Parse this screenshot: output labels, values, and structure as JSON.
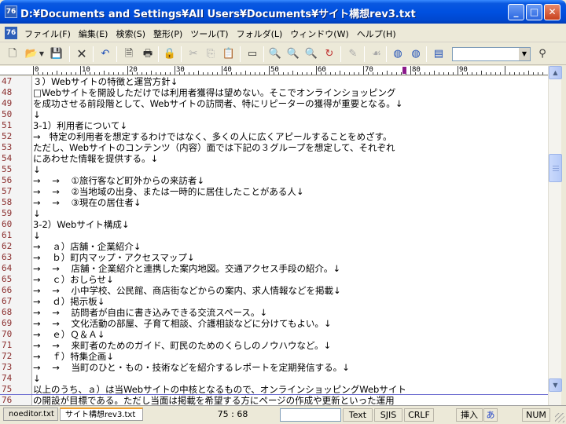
{
  "window": {
    "title": "D:¥Documents and Settings¥All Users¥Documents¥サイト構想rev3.txt",
    "app_icon": "76",
    "minimize": "_",
    "maximize": "□",
    "close": "✕"
  },
  "menu": [
    "ファイル(F)",
    "編集(E)",
    "検索(S)",
    "整形(P)",
    "ツール(T)",
    "フォルダ(L)",
    "ウィンドウ(W)",
    "ヘルプ(H)"
  ],
  "toolbar": {
    "icons": [
      "new-file-icon",
      "open-folder-icon",
      "dropdown-arrow-icon",
      "save-icon",
      "close-doc-icon",
      "undo-icon",
      "print-preview-icon",
      "print-icon",
      "lock-icon",
      "cut-icon",
      "copy-icon",
      "paste-icon",
      "window-icon",
      "search-icon",
      "search-next-icon",
      "search-prev-icon",
      "replace-icon",
      "marker-icon",
      "tag-icon",
      "browser-icon",
      "browser2-icon",
      "grep-icon",
      "binoculars-icon"
    ],
    "search_value": ""
  },
  "ruler": {
    "labels": [
      "0",
      "10",
      "20",
      "30",
      "40",
      "50",
      "60",
      "70",
      "80",
      "90"
    ]
  },
  "editor": {
    "lines": [
      {
        "n": "47",
        "t": "３）Webサイトの特徴と運営方針↓"
      },
      {
        "n": "48",
        "t": "□Webサイトを開設しただけでは利用者獲得は望めない。そこでオンラインショッピング"
      },
      {
        "n": "49",
        "t": "を成功させる前段階として、Webサイトの訪問者、特にリピーターの獲得が重要となる。↓"
      },
      {
        "n": "50",
        "t": "↓"
      },
      {
        "n": "51",
        "t": "3-1）利用者について↓"
      },
      {
        "n": "52",
        "t": "→   特定の利用者を想定するわけではなく、多くの人に広くアピールすることをめざす。"
      },
      {
        "n": "53",
        "t": "ただし、Webサイトのコンテンツ（内容）面では下記の３グループを想定して、それぞれ"
      },
      {
        "n": "54",
        "t": "にあわせた情報を提供する。↓"
      },
      {
        "n": "55",
        "t": "↓"
      },
      {
        "n": "56",
        "t": "→    →    ①旅行客など町外からの来訪者↓"
      },
      {
        "n": "57",
        "t": "→    →    ②当地域の出身、または一時的に居住したことがある人↓"
      },
      {
        "n": "58",
        "t": "→    →    ③現在の居住者↓"
      },
      {
        "n": "59",
        "t": "↓"
      },
      {
        "n": "60",
        "t": "3-2）Webサイト構成↓"
      },
      {
        "n": "61",
        "t": "↓"
      },
      {
        "n": "62",
        "t": "→    ａ）店舗・企業紹介↓"
      },
      {
        "n": "63",
        "t": "→    ｂ）町内マップ・アクセスマップ↓"
      },
      {
        "n": "64",
        "t": "→    →    店舗・企業紹介と連携した案内地図。交通アクセス手段の紹介。↓"
      },
      {
        "n": "65",
        "t": "→    ｃ）おしらせ↓"
      },
      {
        "n": "66",
        "t": "→    →    小中学校、公民館、商店街などからの案内、求人情報などを掲載↓"
      },
      {
        "n": "67",
        "t": "→    ｄ）掲示板↓"
      },
      {
        "n": "68",
        "t": "→    →    訪問者が自由に書き込みできる交流スペース。↓"
      },
      {
        "n": "69",
        "t": "→    →    文化活動の部屋、子育て相談、介護相談などに分けてもよい。↓"
      },
      {
        "n": "70",
        "t": "→    ｅ）Ｑ＆Ａ↓"
      },
      {
        "n": "71",
        "t": "→    →    来町者のためのガイド、町民のためのくらしのノウハウなど。↓"
      },
      {
        "n": "72",
        "t": "→    ｆ）特集企画↓"
      },
      {
        "n": "73",
        "t": "→    →    当町のひと・もの・技術などを紹介するレポートを定期発信する。↓"
      },
      {
        "n": "74",
        "t": "↓"
      },
      {
        "n": "75",
        "t": "以上のうち、ａ）は当Webサイトの中核となるもので、オンラインショッピングWebサイト"
      },
      {
        "n": "76",
        "t": "の開設が目標である。ただし当面は掲載を希望する方にページの作成や更新といった運用"
      }
    ]
  },
  "tabs": [
    "noeditor.txt",
    "サイト構想rev3.txt"
  ],
  "status": {
    "position": "75 : 68",
    "mode": "Text",
    "encoding": "SJIS",
    "linebreak": "CRLF",
    "insert": "挿入",
    "ime": "あ",
    "numlock": "NUM"
  }
}
